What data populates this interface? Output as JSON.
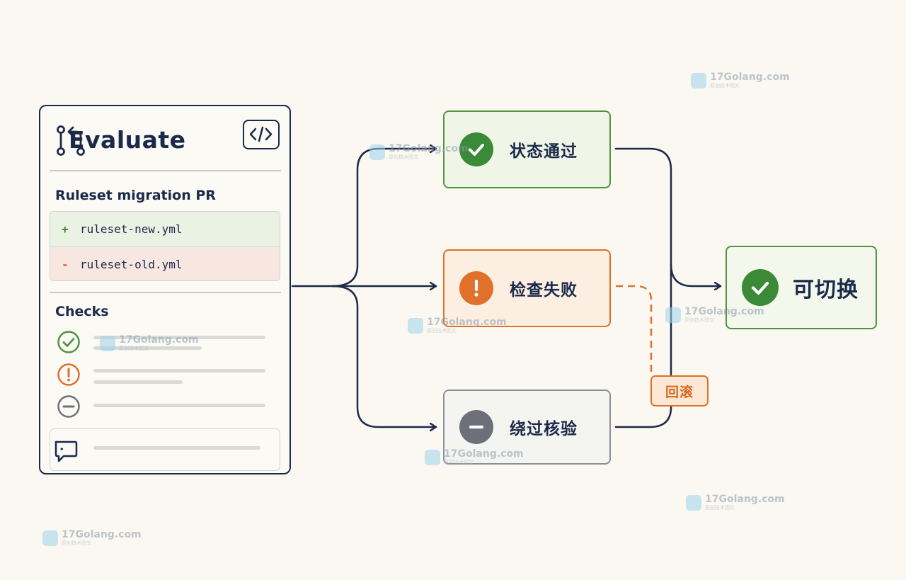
{
  "evaluate_card": {
    "title": "Evaluate",
    "pr_title": "Ruleset migration PR",
    "diff": [
      {
        "sign": "+",
        "file": "ruleset-new.yml"
      },
      {
        "sign": "-",
        "file": "ruleset-old.yml"
      }
    ],
    "checks_label": "Checks"
  },
  "outcomes": {
    "pass": "状态通过",
    "fail": "检查失败",
    "bypass": "绕过核验"
  },
  "result": "可切换",
  "rollback": "回滚",
  "watermark": {
    "main": "17Golang.com",
    "sub": "原创技术图文"
  },
  "colors": {
    "navy": "#1b2a4a",
    "green": "#4f9441",
    "orange": "#e0702a",
    "grey": "#6d7079",
    "background": "#faf8f1"
  },
  "icons": [
    "git-pull-request-icon",
    "code-icon",
    "check-circle-icon",
    "alert-circle-icon",
    "minus-circle-icon",
    "comment-icon"
  ]
}
